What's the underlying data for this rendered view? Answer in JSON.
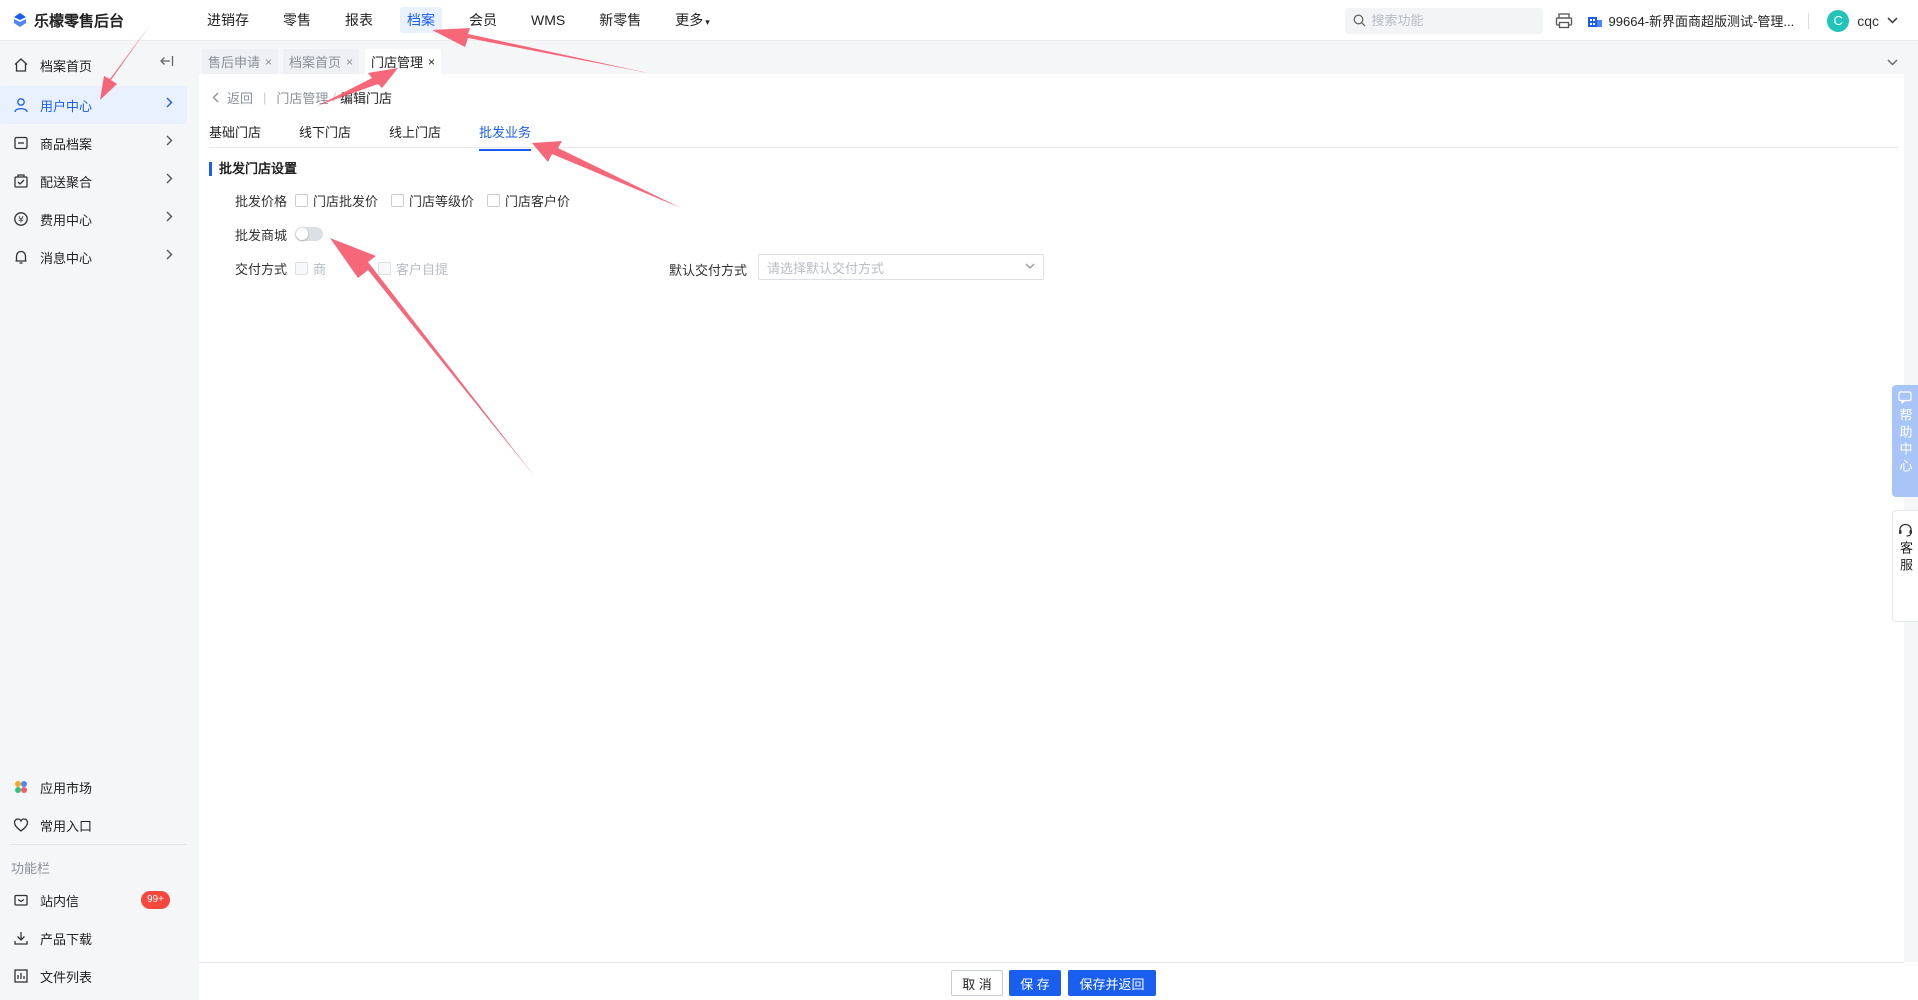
{
  "app": {
    "title": "乐檬零售后台",
    "brand_color": "#1a5ef0"
  },
  "topnav": {
    "items": [
      {
        "label": "进销存"
      },
      {
        "label": "零售"
      },
      {
        "label": "报表"
      },
      {
        "label": "档案"
      },
      {
        "label": "会员"
      },
      {
        "label": "WMS"
      },
      {
        "label": "新零售"
      },
      {
        "label": "更多"
      }
    ],
    "active_index": 3
  },
  "topbar": {
    "search_placeholder": "搜索功能",
    "store_name": "99664-新界面商超版测试-管理...",
    "user_initial": "C",
    "user_name": "cqc"
  },
  "sidebar": {
    "items": [
      {
        "label": "档案首页",
        "icon": "home-icon"
      },
      {
        "label": "用户中心",
        "icon": "user-icon"
      },
      {
        "label": "商品档案",
        "icon": "box-icon"
      },
      {
        "label": "配送聚合",
        "icon": "delivery-icon"
      },
      {
        "label": "费用中心",
        "icon": "yuan-icon"
      },
      {
        "label": "消息中心",
        "icon": "bell-icon"
      }
    ],
    "active_index": 1,
    "bottom_items": [
      {
        "label": "应用市场",
        "icon": "app-market-icon"
      },
      {
        "label": "常用入口",
        "icon": "heart-icon"
      }
    ],
    "section_label": "功能栏",
    "section_items": [
      {
        "label": "站内信",
        "icon": "mail-icon",
        "badge": "99+"
      },
      {
        "label": "产品下载",
        "icon": "download-icon"
      },
      {
        "label": "文件列表",
        "icon": "file-list-icon"
      }
    ]
  },
  "page_tabs": [
    {
      "label": "售后申请"
    },
    {
      "label": "档案首页"
    },
    {
      "label": "门店管理"
    }
  ],
  "breadcrumb": {
    "back": "返回",
    "parent": "门店管理",
    "current": "编辑门店"
  },
  "subtabs": {
    "items": [
      {
        "label": "基础门店"
      },
      {
        "label": "线下门店"
      },
      {
        "label": "线上门店"
      },
      {
        "label": "批发业务"
      }
    ],
    "active_index": 3
  },
  "form": {
    "section_title": "批发门店设置",
    "price_label": "批发价格",
    "price_options": [
      "门店批发价",
      "门店等级价",
      "门店客户价"
    ],
    "mall_label": "批发商城",
    "mall_enabled": false,
    "delivery_label": "交付方式",
    "delivery_options": [
      "商",
      "客户自提"
    ],
    "default_delivery_label": "默认交付方式",
    "default_delivery_placeholder": "请选择默认交付方式"
  },
  "footer": {
    "cancel": "取 消",
    "save": "保 存",
    "save_return": "保存并返回"
  },
  "right_panels": {
    "help": "帮助中心",
    "service": "客服"
  },
  "annotation_color": "#f5576c"
}
